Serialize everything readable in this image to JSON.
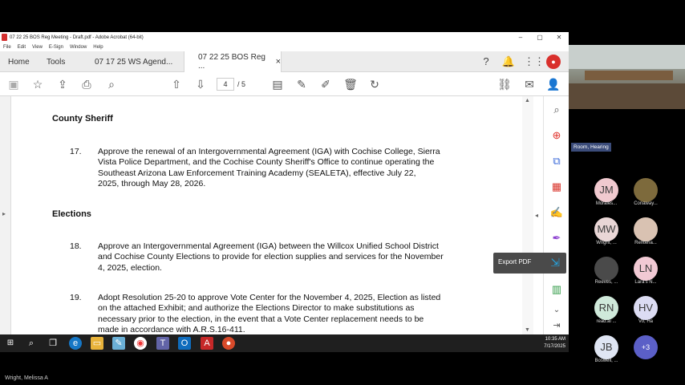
{
  "window": {
    "title": "07 22 25 BOS Reg Meeting - Draft.pdf - Adobe Acrobat (64-bit)",
    "controls": [
      "–",
      "▢",
      "✕"
    ]
  },
  "menu": [
    "File",
    "Edit",
    "View",
    "E-Sign",
    "Window",
    "Help"
  ],
  "tabs": {
    "home": "Home",
    "tools": "Tools",
    "doc1": "07 17 25 WS Agend...",
    "doc2": "07 22 25 BOS Reg ...",
    "close": "×"
  },
  "toolbar": {
    "page_current": "4",
    "page_total": "/ 5"
  },
  "document": {
    "sections": [
      {
        "heading": "County Sheriff",
        "items": [
          {
            "number": "17.",
            "lines": [
              "Approve the renewal of an Intergovernmental Agreement (IGA) with Cochise College, Sierra",
              "Vista Police Department, and the Cochise County Sheriff's Office to continue operating the",
              "Southeast Arizona Law Enforcement Training Academy (SEALETA), effective July 22,",
              "2025, through May 28, 2026."
            ]
          }
        ]
      },
      {
        "heading": "Elections",
        "items": [
          {
            "number": "18.",
            "lines": [
              "Approve an Intergovernmental Agreement (IGA) between the Willcox Unified School District",
              "and Cochise County Elections to provide for election supplies and services for the November",
              "4, 2025, election."
            ]
          },
          {
            "number": "19.",
            "lines": [
              "Adopt Resolution 25-20 to approve Vote Center for the November 4, 2025, Election as listed",
              "on the attached Exhibit; and authorize the Elections Director to make substitutions as",
              "necessary prior to the election, in the event that a Vote Center replacement needs to be",
              "made in accordance with A.R.S.16-411."
            ]
          }
        ]
      }
    ]
  },
  "tooltip": {
    "label": "Export PDF"
  },
  "taskbar": {
    "time": "10:35 AM",
    "date": "7/17/2025"
  },
  "meeting": {
    "room_label": "Room, Hearing",
    "participants": [
      {
        "initials": "JM",
        "name": "Morales...",
        "color": "#f0c9cf"
      },
      {
        "initials": "",
        "name": "Conaway...",
        "color": "#7d6a3c"
      },
      {
        "initials": "MW",
        "name": "Wright, ...",
        "color": "#e9d6d6"
      },
      {
        "initials": "",
        "name": "Renteria...",
        "color": "#d9c2b2"
      },
      {
        "initials": "",
        "name": "Reeves, ...",
        "color": "#4a4a4a"
      },
      {
        "initials": "LN",
        "name": "Lara's N...",
        "color": "#f1c9d4"
      },
      {
        "initials": "RN",
        "name": "read.ai ...",
        "color": "#cfe9da"
      },
      {
        "initials": "HV",
        "name": "Vo, Ha",
        "color": "#dcdcf3"
      },
      {
        "initials": "JB",
        "name": "Boswell, ...",
        "color": "#dfe5f3"
      },
      {
        "initials": "+3",
        "name": "",
        "color": "#5b5fc7"
      }
    ],
    "bottom_name": "Wright, Melissa A"
  }
}
